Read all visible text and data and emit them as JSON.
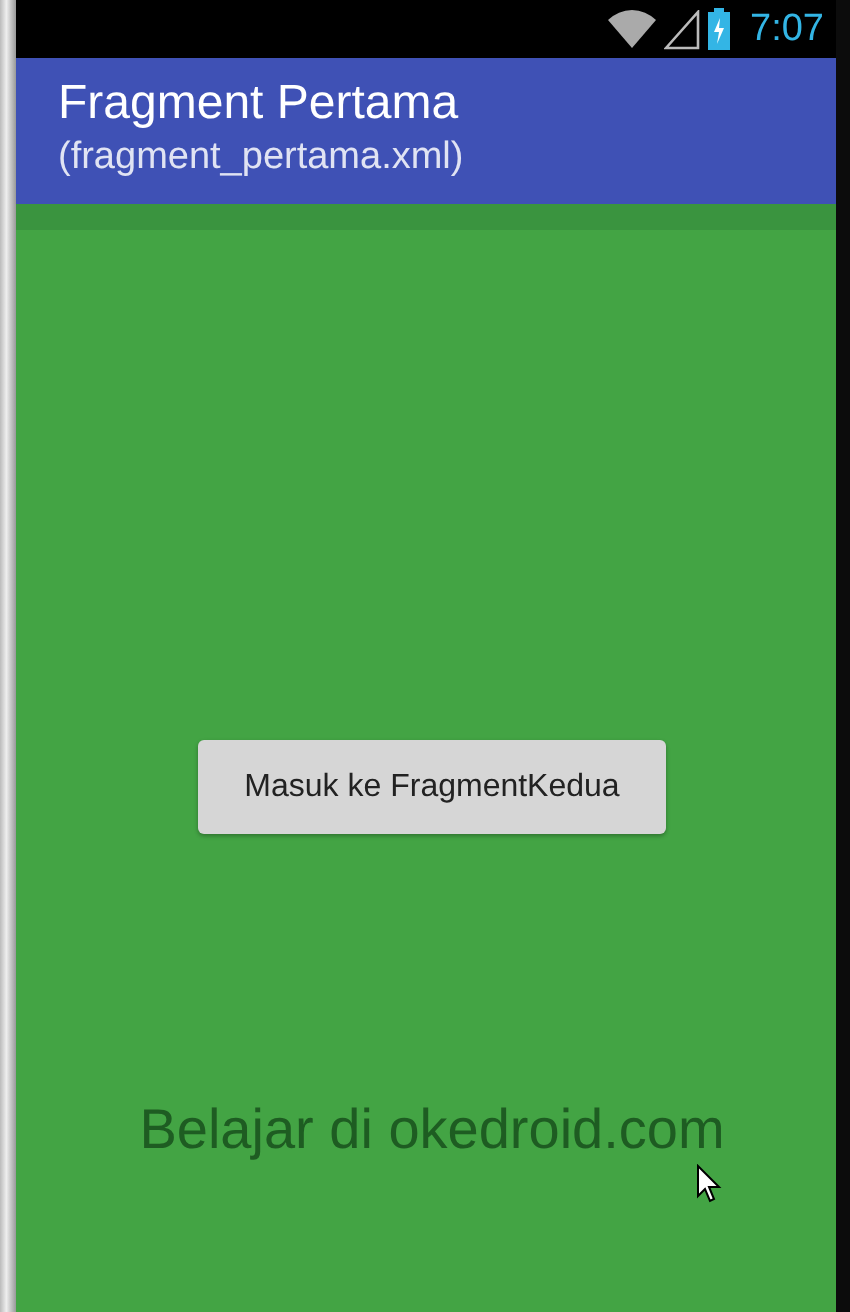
{
  "status_bar": {
    "time": "7:07"
  },
  "app_bar": {
    "title": "Fragment Pertama",
    "subtitle": "(fragment_pertama.xml)"
  },
  "content": {
    "button": "Masuk ke FragmentKedua",
    "footer_text": "Belajar di okedroid.com"
  }
}
